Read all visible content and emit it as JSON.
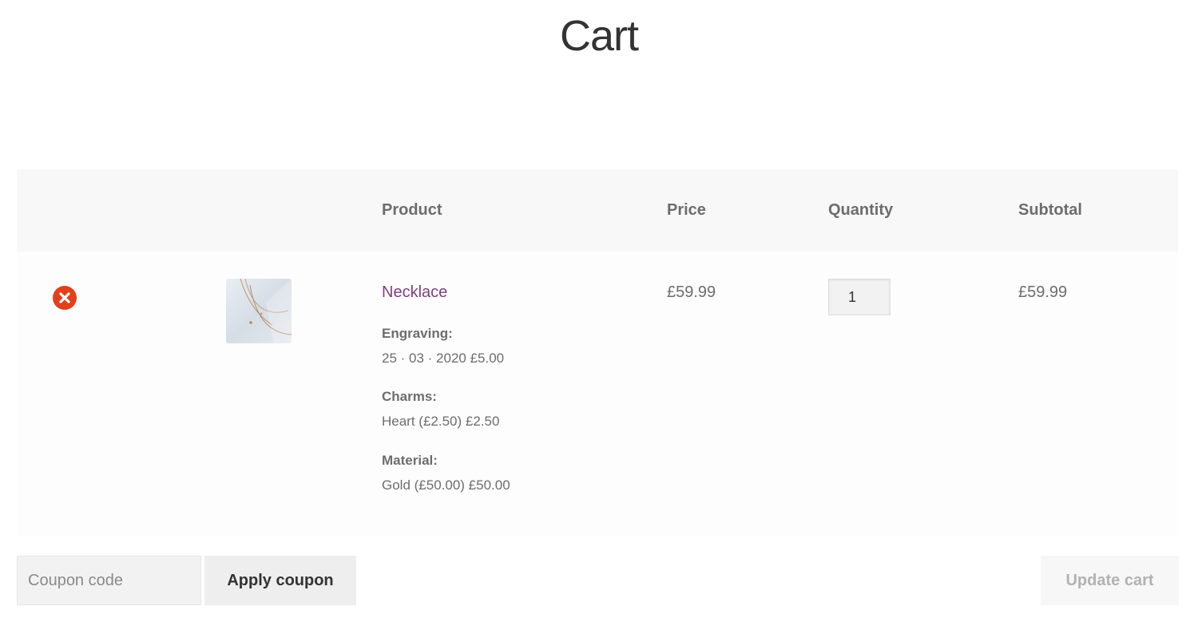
{
  "page": {
    "title": "Cart"
  },
  "cart_table": {
    "headers": {
      "product": "Product",
      "price": "Price",
      "quantity": "Quantity",
      "subtotal": "Subtotal"
    },
    "items": [
      {
        "name": "Necklace",
        "price": "£59.99",
        "quantity": "1",
        "subtotal": "£59.99",
        "remove_icon": "remove-x-circle-icon",
        "thumbnail_icon": "necklace-thumbnail",
        "meta": [
          {
            "key": "Engraving:",
            "value": "25 · 03 · 2020 £5.00"
          },
          {
            "key": "Charms:",
            "value": "Heart (£2.50) £2.50"
          },
          {
            "key": "Material:",
            "value": "Gold (£50.00) £50.00"
          }
        ]
      }
    ]
  },
  "actions": {
    "coupon_placeholder": "Coupon code",
    "coupon_value": "",
    "apply_coupon_label": "Apply coupon",
    "update_cart_label": "Update cart"
  },
  "colors": {
    "title": "#333333",
    "header_bg": "#f8f8f8",
    "row_bg": "#fdfdfd",
    "product_link": "#7f3f7f",
    "remove_icon": "#e2401c",
    "text": "#6d6d6d",
    "button_bg": "#eeeeee",
    "disabled_text": "#b2b2b2"
  }
}
